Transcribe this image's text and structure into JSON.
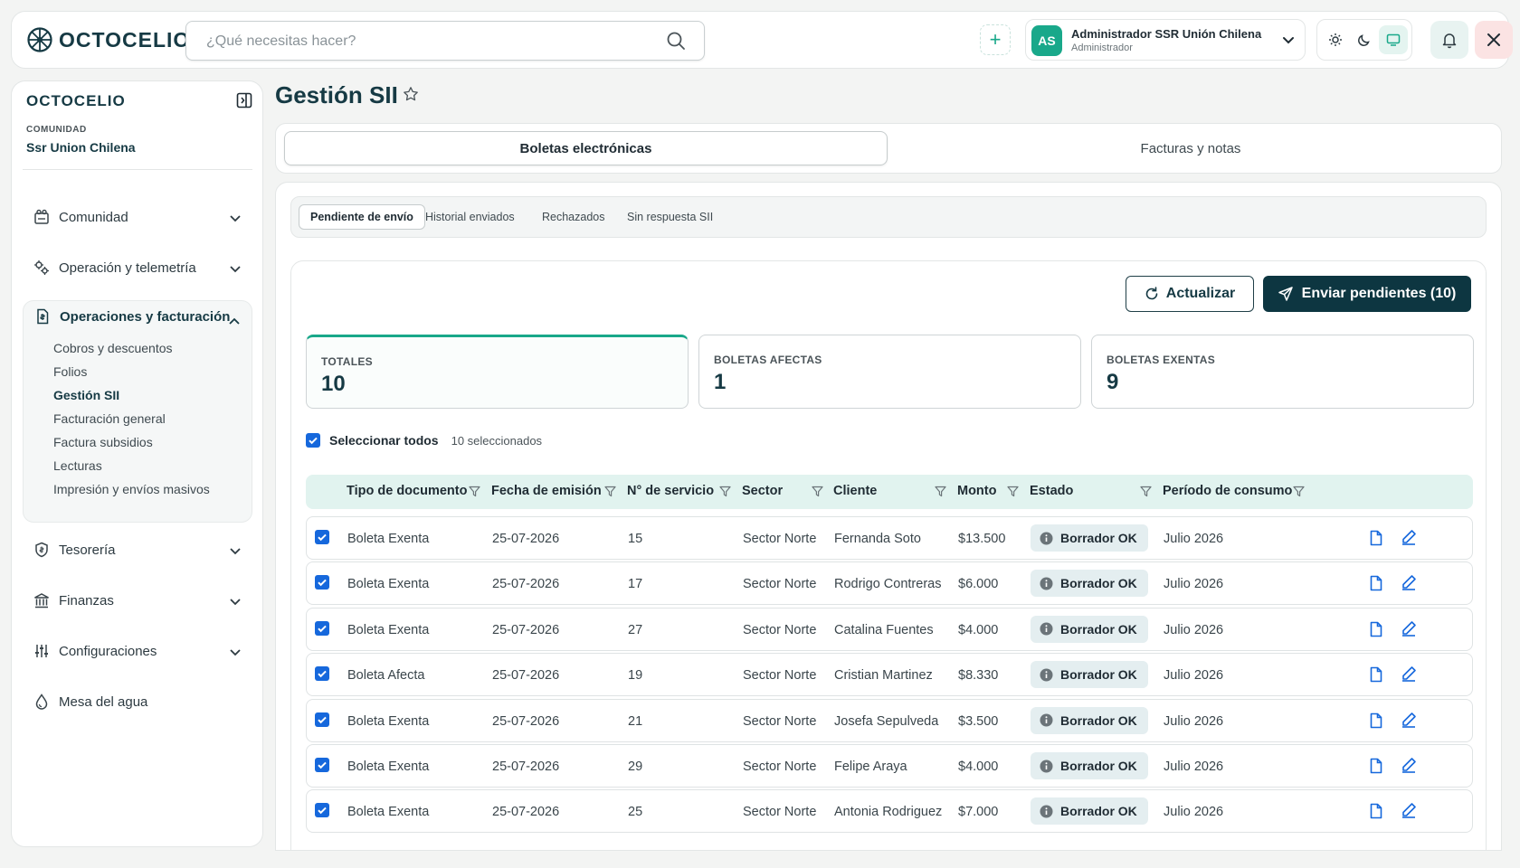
{
  "brand": {
    "name": "OCTOCELIO"
  },
  "search": {
    "placeholder": "¿Qué necesitas hacer?"
  },
  "user": {
    "initials": "AS",
    "name": "Administrador SSR Unión Chilena",
    "role": "Administrador"
  },
  "sidebar": {
    "logo": "OCTOCELIO",
    "community_label": "COMUNIDAD",
    "community_name": "Ssr Union Chilena",
    "items": [
      {
        "label": "Comunidad",
        "icon": "community-icon"
      },
      {
        "label": "Operación y telemetría",
        "icon": "gears-icon"
      },
      {
        "label": "Operaciones y facturación",
        "icon": "invoice-icon",
        "expanded": true
      },
      {
        "label": "Tesorería",
        "icon": "shield-dollar-icon"
      },
      {
        "label": "Finanzas",
        "icon": "bank-icon"
      },
      {
        "label": "Configuraciones",
        "icon": "sliders-icon"
      },
      {
        "label": "Mesa del agua",
        "icon": "water-drop-icon"
      }
    ],
    "subitems": [
      "Cobros y descuentos",
      "Folios",
      "Gestión SII",
      "Facturación general",
      "Factura subsidios",
      "Lecturas",
      "Impresión y envíos masivos"
    ],
    "active_subitem": "Gestión SII"
  },
  "page": {
    "title": "Gestión SII"
  },
  "doc_tabs": [
    "Boletas electrónicas",
    "Facturas y notas"
  ],
  "sub_tabs": [
    "Pendiente de envío",
    "Historial enviados",
    "Rechazados",
    "Sin respuesta SII"
  ],
  "actions": {
    "update": "Actualizar",
    "send": "Enviar pendientes (10)"
  },
  "stats": [
    {
      "label": "TOTALES",
      "value": "10"
    },
    {
      "label": "BOLETAS AFECTAS",
      "value": "1"
    },
    {
      "label": "BOLETAS EXENTAS",
      "value": "9"
    }
  ],
  "selection": {
    "label": "Seleccionar todos",
    "count": "10 seleccionados"
  },
  "table": {
    "columns": [
      "Tipo de documento",
      "Fecha de emisión",
      "N° de servicio",
      "Sector",
      "Cliente",
      "Monto",
      "Estado",
      "Período de consumo"
    ],
    "rows": [
      [
        "Boleta Exenta",
        "25-07-2026",
        "15",
        "Sector Norte",
        "Fernanda Soto",
        "$13.500",
        "Borrador OK",
        "Julio 2026"
      ],
      [
        "Boleta Exenta",
        "25-07-2026",
        "17",
        "Sector Norte",
        "Rodrigo Contreras",
        "$6.000",
        "Borrador OK",
        "Julio 2026"
      ],
      [
        "Boleta Exenta",
        "25-07-2026",
        "27",
        "Sector Norte",
        "Catalina Fuentes",
        "$4.000",
        "Borrador OK",
        "Julio 2026"
      ],
      [
        "Boleta Afecta",
        "25-07-2026",
        "19",
        "Sector Norte",
        "Cristian Martinez",
        "$8.330",
        "Borrador OK",
        "Julio 2026"
      ],
      [
        "Boleta Exenta",
        "25-07-2026",
        "21",
        "Sector Norte",
        "Josefa Sepulveda",
        "$3.500",
        "Borrador OK",
        "Julio 2026"
      ],
      [
        "Boleta Exenta",
        "25-07-2026",
        "29",
        "Sector Norte",
        "Felipe Araya",
        "$4.000",
        "Borrador OK",
        "Julio 2026"
      ],
      [
        "Boleta Exenta",
        "25-07-2026",
        "25",
        "Sector Norte",
        "Antonia Rodriguez",
        "$7.000",
        "Borrador OK",
        "Julio 2026"
      ]
    ]
  },
  "colors": {
    "brand": "#163a44",
    "accent": "#19a88a",
    "primary_button": "#0d3641",
    "checkbox": "#1668dc",
    "action_icon": "#1668dc"
  }
}
